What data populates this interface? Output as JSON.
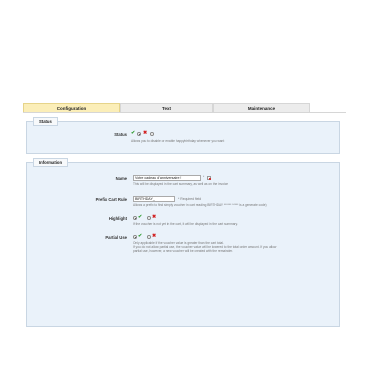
{
  "tabs": [
    {
      "label": "Configuration",
      "active": true
    },
    {
      "label": "Text",
      "active": false
    },
    {
      "label": "Maintenance",
      "active": false
    }
  ],
  "status_section": {
    "legend": "Status",
    "status_label": "Status",
    "status_value": "enabled",
    "help": "Allows you to disable or enable happybirthday whenever you want"
  },
  "info_section": {
    "legend": "Information",
    "name_label": "Name",
    "name_value": "Votre cadeau d'anniversaire !",
    "name_help": "This will be displayed in the cart summary, as well as on the invoice",
    "prefix_label": "Prefix Cart Rule",
    "prefix_value": "BIRTHDAY_",
    "prefix_required": "* Required field",
    "prefix_help": "Allows a prefix to find simply voucher in cart reading BIRTHDAY ****** ***** is a generate code)",
    "highlight_label": "Highlight",
    "highlight_value": "yes",
    "highlight_help": "If the voucher is not yet in the cart, it will be displayed in the cart summary.",
    "partial_label": "Partial Use",
    "partial_value": "yes",
    "partial_help_1": "Only applicable if the voucher value is greater than the cart total.",
    "partial_help_2": "If you do not allow partial use, the voucher value will be lowered to the total order amount. If you allow",
    "partial_help_3": "partial use, however, a new voucher will be created with the remainder."
  },
  "colors": {
    "active_tab": "#fbeeb8",
    "fieldset_bg": "#eaf2fa",
    "yes": "#2f9b2f",
    "no": "#d22020"
  },
  "icons": [
    "check-icon",
    "cross-icon",
    "flag-icon"
  ]
}
